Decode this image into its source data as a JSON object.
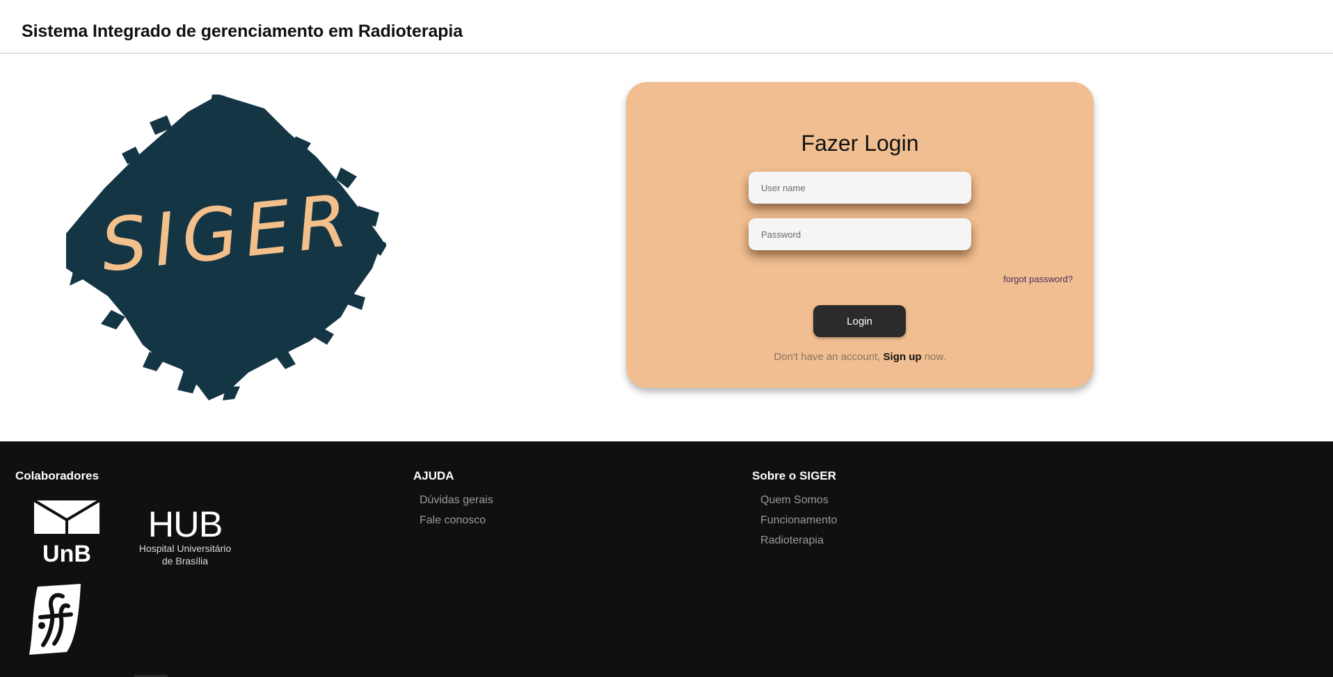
{
  "header": {
    "title": "Sistema Integrado de gerenciamento em Radioterapia"
  },
  "logo": {
    "text": "SIGER",
    "icon": "siger-brush-logo",
    "brush_color": "#143544",
    "text_color": "#f3c08c"
  },
  "login": {
    "title": "Fazer Login",
    "username_placeholder": "User name",
    "password_placeholder": "Password",
    "forgot_label": "forgot password?",
    "button_label": "Login",
    "signup_prefix": "Don't have an account,",
    "signup_link": "Sign up",
    "signup_suffix": "now.",
    "card_color": "#f0be90"
  },
  "footer": {
    "colaboradores": {
      "heading": "Colaboradores",
      "unb_text": "UnB",
      "hub_title": "HUB",
      "hub_line1": "Hospital Universitário",
      "hub_line2": "de Brasília"
    },
    "ajuda": {
      "heading": "AJUDA",
      "links": [
        "Dúvidas gerais",
        "Fale conosco"
      ]
    },
    "sobre": {
      "heading": "Sobre o SIGER",
      "links": [
        "Quem Somos",
        "Funcionamento",
        "Radioterapia"
      ]
    },
    "background": "#101010"
  }
}
